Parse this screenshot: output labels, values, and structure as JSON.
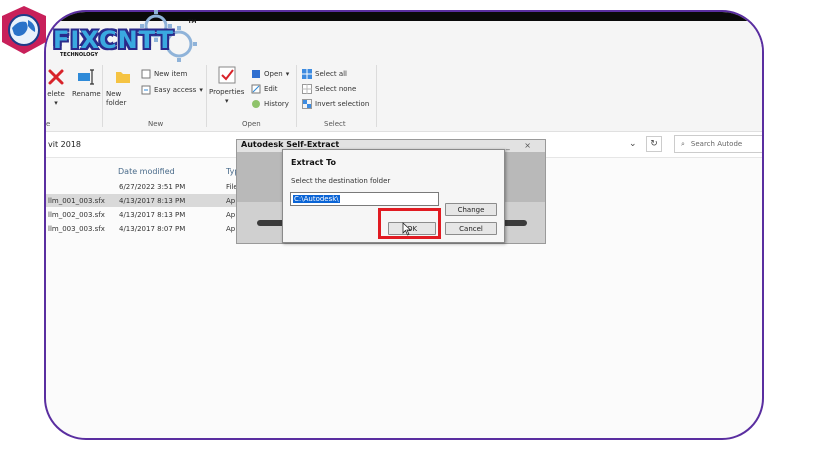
{
  "logo": {
    "wordmark": "FIXCNTT",
    "tagline": "TECHNOLOGY",
    "trademark": "TM"
  },
  "ribbon": {
    "buttons": {
      "delete": "elete",
      "rename": "Rename",
      "new_folder": "New folder",
      "properties": "Properties",
      "new_item": "New item",
      "easy_access": "Easy access",
      "open": "Open",
      "edit": "Edit",
      "history": "History",
      "select_all": "Select all",
      "select_none": "Select none",
      "invert_selection": "Invert selection"
    },
    "groups": {
      "organize": "e",
      "new": "New",
      "open": "Open",
      "select": "Select"
    }
  },
  "address": {
    "path_fragment": "vit 2018",
    "search_placeholder": "Search Autode"
  },
  "file_list": {
    "headers": {
      "date_modified": "Date modified",
      "type": "Typ"
    },
    "rows": [
      {
        "name": "",
        "date": "6/27/2022 3:51 PM",
        "type": "File"
      },
      {
        "name": "llm_001_003.sfx",
        "date": "4/13/2017 8:13 PM",
        "type": "Ap"
      },
      {
        "name": "llm_002_003.sfx",
        "date": "4/13/2017 8:13 PM",
        "type": "Ap"
      },
      {
        "name": "llm_003_003.sfx",
        "date": "4/13/2017 8:07 PM",
        "type": "Ap"
      }
    ]
  },
  "bg_window": {
    "title": "Autodesk Self-Extract",
    "controls": "_ ×"
  },
  "dialog": {
    "title": "Extract To",
    "subtitle": "Select the destination folder",
    "path_value": "C:\\Autodesk\\",
    "change_label": "Change",
    "ok_label": "OK",
    "cancel_label": "Cancel"
  },
  "colors": {
    "frame": "#5a2ea0",
    "highlight_ring": "#e11b22",
    "selection": "#0a64d6"
  }
}
